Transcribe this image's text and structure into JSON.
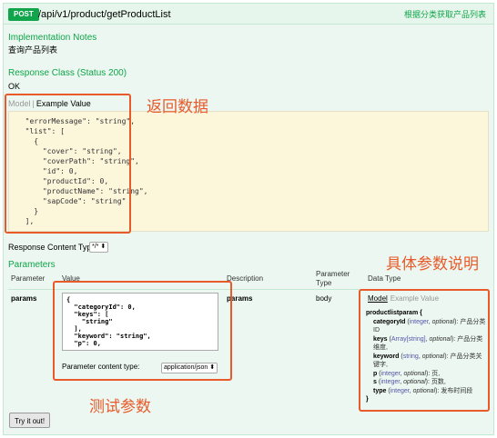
{
  "operation": {
    "method": "POST",
    "path": "/api/v1/product/getProductList",
    "summary": "根据分类获取产品列表"
  },
  "implementation_notes": {
    "heading": "Implementation Notes",
    "text": "查询产品列表"
  },
  "response_class": {
    "heading": "Response Class (Status 200)",
    "status_text": "OK",
    "tab_model": "Model",
    "tab_separator": "|",
    "tab_example": "Example Value",
    "example_json": "  \"errorMessage\": \"string\",\n  \"list\": [\n    {\n      \"cover\": \"string\",\n      \"coverPath\": \"string\",\n      \"id\": 0,\n      \"productId\": 0,\n      \"productName\": \"string\",\n      \"sapCode\": \"string\"\n    }\n  ],"
  },
  "annotations": {
    "return_data": "返回数据",
    "param_description": "具体参数说明",
    "test_params": "测试参数"
  },
  "response_content_type": {
    "label": "Response Content Type",
    "value": "*/* ⬍"
  },
  "parameters": {
    "heading": "Parameters",
    "columns": {
      "parameter": "Parameter",
      "value": "Value",
      "description": "Description",
      "parameter_type": "Parameter Type",
      "data_type": "Data Type"
    },
    "row": {
      "name": "params",
      "value_json": "{\n  \"categoryId\": 0,\n  \"keys\": [\n    \"string\"\n  ],\n  \"keyword\": \"string\",\n  \"p\": 0,",
      "description": "params",
      "parameter_type": "body"
    },
    "content_type_label": "Parameter content type:",
    "content_type_value": "application/json ⬍"
  },
  "data_type": {
    "tab_model": "Model",
    "tab_example": "Example Value",
    "model_name": "productlistparam {",
    "fields": [
      {
        "name": "categoryId",
        "type": "integer",
        "optional": "optional",
        "desc": "产品分类ID"
      },
      {
        "name": "keys",
        "type": "Array[string]",
        "optional": "optional",
        "desc": "产品分类维度,"
      },
      {
        "name": "keyword",
        "type": "string",
        "optional": "optional",
        "desc": "产品分类关键字,"
      },
      {
        "name": "p",
        "type": "integer",
        "optional": "optional",
        "desc": "页,"
      },
      {
        "name": "s",
        "type": "integer",
        "optional": "optional",
        "desc": "页数,"
      },
      {
        "name": "type",
        "type": "integer",
        "optional": "optional",
        "desc": "发布时间段"
      }
    ],
    "close_brace": "}"
  },
  "try_button": "Try it out!",
  "colors": {
    "accent": "#10a54a",
    "annotation": "#e85a2a",
    "background": "#ebf7f0",
    "code_bg": "#fcf6db"
  }
}
